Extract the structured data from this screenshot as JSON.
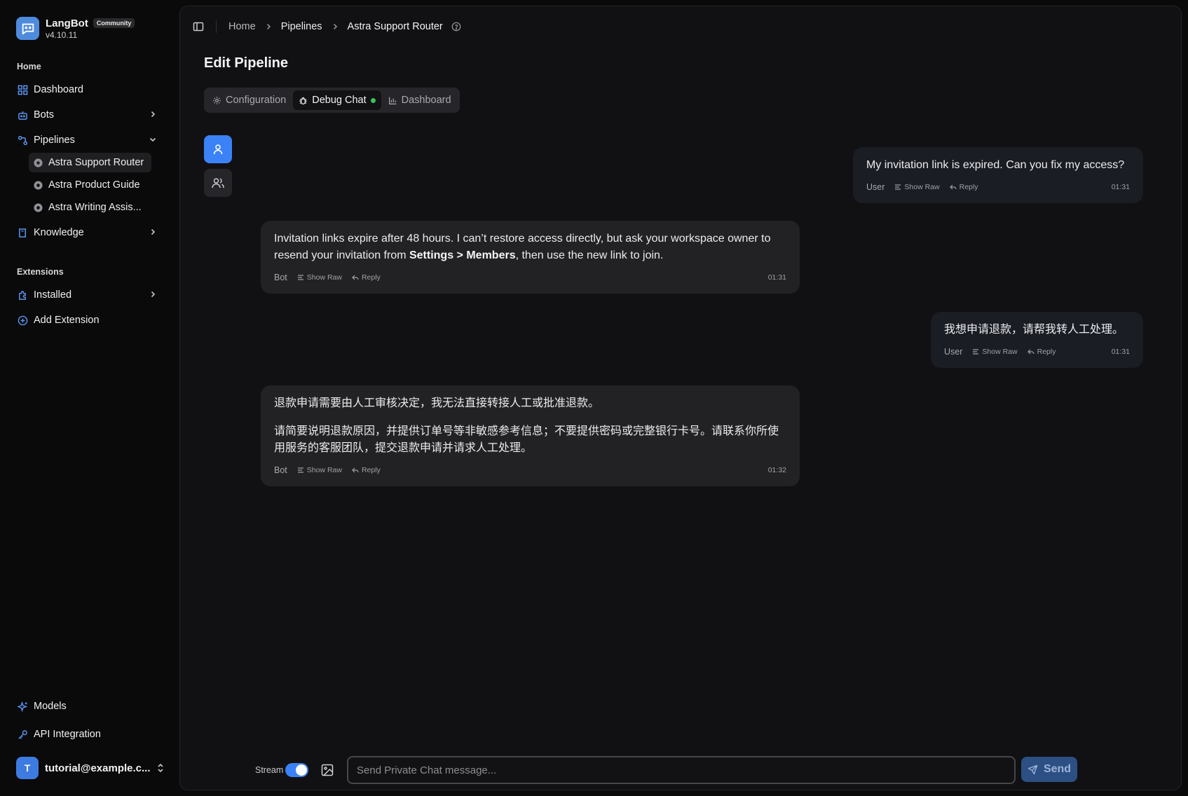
{
  "brand": {
    "name": "LangBot",
    "badge": "Community",
    "version": "v4.10.11"
  },
  "sidebar": {
    "home_label": "Home",
    "items": [
      {
        "label": "Dashboard",
        "icon": "dashboard-icon"
      },
      {
        "label": "Bots",
        "icon": "bot-icon"
      },
      {
        "label": "Pipelines",
        "icon": "pipeline-icon"
      },
      {
        "label": "Knowledge",
        "icon": "book-icon"
      }
    ],
    "pipelines": [
      "Astra Support Router",
      "Astra Product Guide",
      "Astra Writing Assis..."
    ],
    "extensions_label": "Extensions",
    "extensions": [
      {
        "label": "Installed",
        "icon": "puzzle-icon"
      },
      {
        "label": "Add Extension",
        "icon": "plus-circle-icon"
      }
    ],
    "bottom": [
      {
        "label": "Models",
        "icon": "sparkle-icon"
      },
      {
        "label": "API Integration",
        "icon": "key-icon"
      }
    ],
    "user": {
      "initial": "T",
      "email": "tutorial@example.c..."
    }
  },
  "breadcrumb": {
    "home": "Home",
    "section": "Pipelines",
    "current": "Astra Support Router"
  },
  "page_title": "Edit Pipeline",
  "tabs": [
    "Configuration",
    "Debug Chat",
    "Dashboard"
  ],
  "messages": [
    {
      "role": "User",
      "text": "My invitation link is expired. Can you fix my access?",
      "time": "01:31"
    },
    {
      "role": "Bot",
      "text_before": "Invitation links expire after 48 hours. I can’t restore access directly, but ask your workspace owner to resend your invitation from ",
      "text_bold": "Settings > Members",
      "text_after": ", then use the new link to join.",
      "time": "01:31"
    },
    {
      "role": "User",
      "text": "我想申请退款，请帮我转人工处理。",
      "time": "01:31"
    },
    {
      "role": "Bot",
      "para1": "退款申请需要由人工审核决定，我无法直接转接人工或批准退款。",
      "para2": "请简要说明退款原因，并提供订单号等非敏感参考信息；不要提供密码或完整银行卡号。请联系你所使用服务的客服团队，提交退款申请并请求人工处理。",
      "time": "01:32"
    }
  ],
  "actions": {
    "show_raw": "Show Raw",
    "reply": "Reply"
  },
  "composer": {
    "stream_label": "Stream",
    "stream_on": true,
    "placeholder": "Send Private Chat message...",
    "send_label": "Send"
  },
  "colors": {
    "accent": "#3b82f6",
    "online": "#34c85a",
    "background": "#0a0a0b"
  }
}
